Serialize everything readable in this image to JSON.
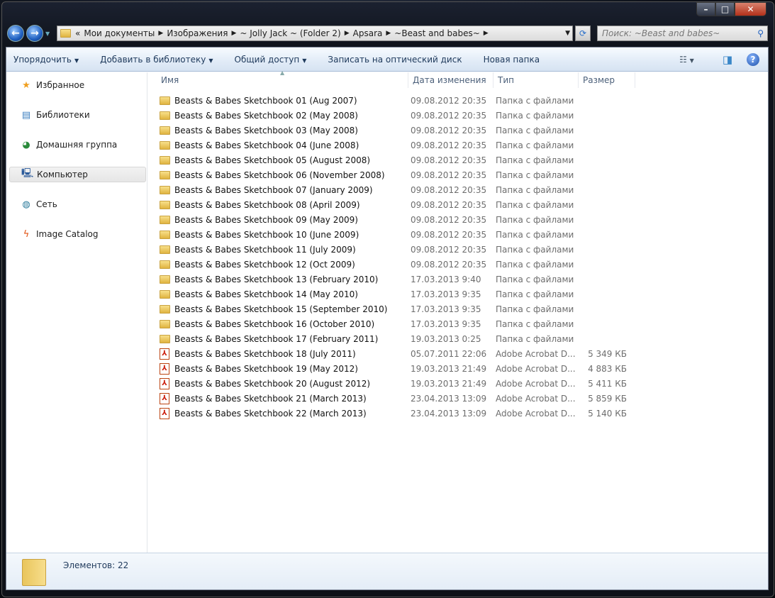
{
  "address": {
    "overflow": "«",
    "segments": [
      "Мои документы",
      "Изображения",
      "~ Jolly Jack ~ (Folder 2)",
      "Apsara",
      "~Beast and babes~"
    ]
  },
  "search": {
    "placeholder": "Поиск: ~Beast and babes~"
  },
  "toolbar": {
    "organize": "Упорядочить",
    "add_library": "Добавить в библиотеку",
    "share": "Общий доступ",
    "burn": "Записать на оптический диск",
    "new_folder": "Новая папка"
  },
  "sidebar": {
    "items": [
      {
        "label": "Избранное"
      },
      {
        "label": "Библиотеки"
      },
      {
        "label": "Домашняя группа"
      },
      {
        "label": "Компьютер"
      },
      {
        "label": "Сеть"
      },
      {
        "label": "Image Catalog"
      }
    ]
  },
  "columns": {
    "name": "Имя",
    "date": "Дата изменения",
    "type": "Тип",
    "size": "Размер"
  },
  "files": [
    {
      "name": "Beasts & Babes Sketchbook 01 (Aug 2007)",
      "date": "09.08.2012 20:35",
      "type": "Папка с файлами",
      "size": "",
      "kind": "folder"
    },
    {
      "name": "Beasts & Babes Sketchbook 02 (May 2008)",
      "date": "09.08.2012 20:35",
      "type": "Папка с файлами",
      "size": "",
      "kind": "folder"
    },
    {
      "name": "Beasts & Babes Sketchbook 03 (May 2008)",
      "date": "09.08.2012 20:35",
      "type": "Папка с файлами",
      "size": "",
      "kind": "folder"
    },
    {
      "name": "Beasts & Babes Sketchbook 04 (June 2008)",
      "date": "09.08.2012 20:35",
      "type": "Папка с файлами",
      "size": "",
      "kind": "folder"
    },
    {
      "name": "Beasts & Babes Sketchbook 05 (August 2008)",
      "date": "09.08.2012 20:35",
      "type": "Папка с файлами",
      "size": "",
      "kind": "folder"
    },
    {
      "name": "Beasts & Babes Sketchbook 06 (November 2008)",
      "date": "09.08.2012 20:35",
      "type": "Папка с файлами",
      "size": "",
      "kind": "folder"
    },
    {
      "name": "Beasts & Babes Sketchbook 07 (January 2009)",
      "date": "09.08.2012 20:35",
      "type": "Папка с файлами",
      "size": "",
      "kind": "folder"
    },
    {
      "name": "Beasts & Babes Sketchbook 08 (April 2009)",
      "date": "09.08.2012 20:35",
      "type": "Папка с файлами",
      "size": "",
      "kind": "folder"
    },
    {
      "name": "Beasts & Babes Sketchbook 09 (May 2009)",
      "date": "09.08.2012 20:35",
      "type": "Папка с файлами",
      "size": "",
      "kind": "folder"
    },
    {
      "name": "Beasts & Babes Sketchbook 10 (June 2009)",
      "date": "09.08.2012 20:35",
      "type": "Папка с файлами",
      "size": "",
      "kind": "folder"
    },
    {
      "name": "Beasts & Babes Sketchbook 11 (July 2009)",
      "date": "09.08.2012 20:35",
      "type": "Папка с файлами",
      "size": "",
      "kind": "folder"
    },
    {
      "name": "Beasts & Babes Sketchbook 12 (Oct 2009)",
      "date": "09.08.2012 20:35",
      "type": "Папка с файлами",
      "size": "",
      "kind": "folder"
    },
    {
      "name": "Beasts & Babes Sketchbook 13  (February 2010)",
      "date": "17.03.2013 9:40",
      "type": "Папка с файлами",
      "size": "",
      "kind": "folder"
    },
    {
      "name": "Beasts & Babes Sketchbook 14 (May 2010)",
      "date": "17.03.2013 9:35",
      "type": "Папка с файлами",
      "size": "",
      "kind": "folder"
    },
    {
      "name": "Beasts & Babes Sketchbook 15 (September 2010)",
      "date": "17.03.2013 9:35",
      "type": "Папка с файлами",
      "size": "",
      "kind": "folder"
    },
    {
      "name": "Beasts & Babes Sketchbook 16 (October 2010)",
      "date": "17.03.2013 9:35",
      "type": "Папка с файлами",
      "size": "",
      "kind": "folder"
    },
    {
      "name": "Beasts & Babes Sketchbook 17 (February 2011)",
      "date": "19.03.2013 0:25",
      "type": "Папка с файлами",
      "size": "",
      "kind": "folder"
    },
    {
      "name": "Beasts & Babes Sketchbook 18 (July 2011)",
      "date": "05.07.2011 22:06",
      "type": "Adobe Acrobat D...",
      "size": "5 349 КБ",
      "kind": "pdf"
    },
    {
      "name": "Beasts & Babes Sketchbook 19 (May 2012)",
      "date": "19.03.2013 21:49",
      "type": "Adobe Acrobat D...",
      "size": "4 883 КБ",
      "kind": "pdf"
    },
    {
      "name": "Beasts & Babes Sketchbook 20 (August 2012)",
      "date": "19.03.2013 21:49",
      "type": "Adobe Acrobat D...",
      "size": "5 411 КБ",
      "kind": "pdf"
    },
    {
      "name": "Beasts & Babes Sketchbook 21 (March 2013)",
      "date": "23.04.2013 13:09",
      "type": "Adobe Acrobat D...",
      "size": "5 859 КБ",
      "kind": "pdf"
    },
    {
      "name": "Beasts & Babes Sketchbook 22 (March 2013)",
      "date": "23.04.2013 13:09",
      "type": "Adobe Acrobat D...",
      "size": "5 140 КБ",
      "kind": "pdf"
    }
  ],
  "status": {
    "count": "Элементов: 22"
  }
}
